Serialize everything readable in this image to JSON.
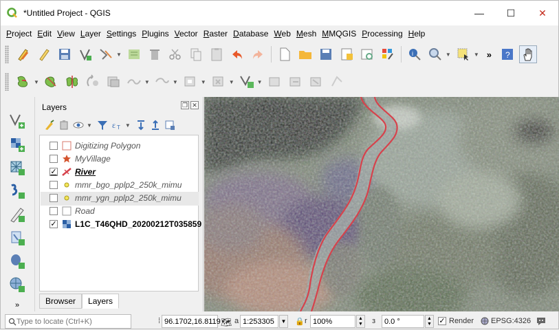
{
  "window": {
    "title": "*Untitled Project - QGIS",
    "min_glyph": "—",
    "max_glyph": "☐",
    "close_glyph": "✕"
  },
  "menu": [
    "Project",
    "Edit",
    "View",
    "Layer",
    "Settings",
    "Plugins",
    "Vector",
    "Raster",
    "Database",
    "Web",
    "Mesh",
    "MMQGIS",
    "Processing",
    "Help"
  ],
  "toolbar": {
    "overflow": "»"
  },
  "layers_panel": {
    "title": "Layers",
    "float_glyph": "❐",
    "close_glyph": "✕",
    "layers": [
      {
        "name": "Digitizing Polygon",
        "checked": false,
        "symbol": "polygon-empty-icon"
      },
      {
        "name": "MyVillage",
        "checked": false,
        "symbol": "star-icon"
      },
      {
        "name": "River",
        "checked": true,
        "symbol": "line-icon"
      },
      {
        "name": "mmr_bgo_pplp2_250k_mimu",
        "checked": false,
        "symbol": "point-icon"
      },
      {
        "name": "mmr_ygn_pplp2_250k_mimu",
        "checked": false,
        "symbol": "point-icon"
      },
      {
        "name": "Road",
        "checked": false,
        "symbol": "polygon-empty-icon"
      },
      {
        "name": "L1C_T46QHD_20200212T035859",
        "checked": true,
        "symbol": "raster-icon"
      }
    ],
    "check_glyph": "✓",
    "tabs": [
      "Browser",
      "Layers"
    ],
    "active_tab": "Layers"
  },
  "statusbar": {
    "locate_placeholder": "Type to locate (Ctrl+K)",
    "coordinate": "96.1702,16.8119",
    "scale": "1:253305",
    "magnifier": "100%",
    "rotation": "0.0 °",
    "render_label": "Render",
    "crs": "EPSG:4326"
  },
  "colors": {
    "river": "#d6424c",
    "accent": "#c42b1c"
  }
}
